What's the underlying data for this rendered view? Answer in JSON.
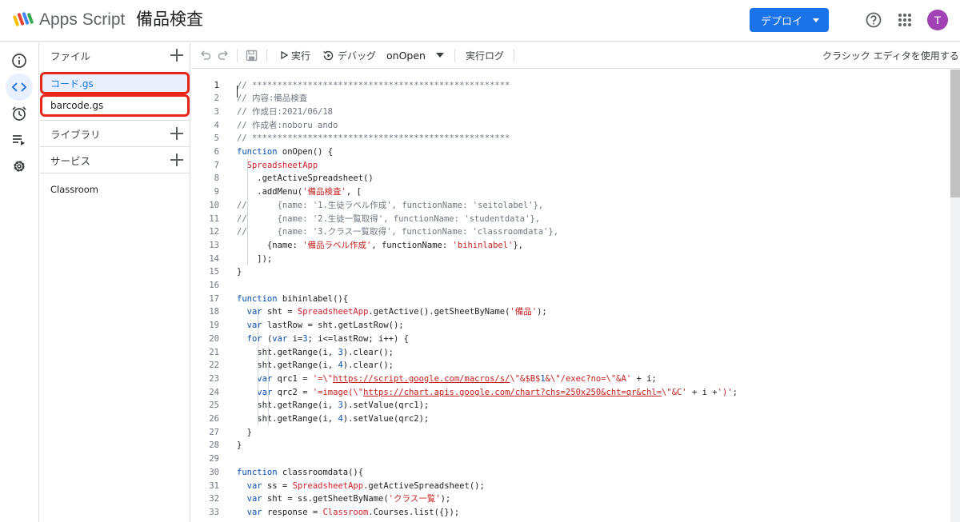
{
  "app": {
    "name": "Apps Script",
    "project_title": "備品検査"
  },
  "header": {
    "deploy_label": "デプロイ",
    "avatar_initial": "T"
  },
  "files_panel": {
    "files_header": "ファイル",
    "files": [
      {
        "name": "コード.gs",
        "active": true,
        "highlighted": true
      },
      {
        "name": "barcode.gs",
        "active": false,
        "highlighted": true
      }
    ],
    "libraries_header": "ライブラリ",
    "services_header": "サービス",
    "services": [
      "Classroom"
    ]
  },
  "toolbar": {
    "run_label": "実行",
    "debug_label": "デバッグ",
    "function_name": "onOpen",
    "log_label": "実行ログ",
    "classic_editor_label": "クラシック エディタを使用する"
  },
  "editor": {
    "current_line": 1,
    "lines": [
      {
        "n": "1",
        "t": "// ***************************************************",
        "c": "cm"
      },
      {
        "n": "2",
        "t": "// 内容:備品検査",
        "c": "cm"
      },
      {
        "n": "3",
        "t": "// 作成日:2021/06/18",
        "c": "cm"
      },
      {
        "n": "4",
        "t": "// 作成者:noboru ando",
        "c": "cm"
      },
      {
        "n": "5",
        "t": "// ***************************************************",
        "c": "cm"
      },
      {
        "n": "6",
        "t": "function onOpen() {",
        "c": "fn"
      },
      {
        "n": "7",
        "t": "  SpreadsheetApp",
        "c": "cls"
      },
      {
        "n": "8",
        "t": "    .getActiveSpreadsheet()",
        "c": ""
      },
      {
        "n": "9",
        "t": "    .addMenu('備品検査', [",
        "c": "menu"
      },
      {
        "n": "10",
        "t": "//      {name: '1.生徒ラベル作成', functionName: 'seitolabel'},",
        "c": "cm"
      },
      {
        "n": "11",
        "t": "//      {name: '2.生徒一覧取得', functionName: 'studentdata'},",
        "c": "cm"
      },
      {
        "n": "12",
        "t": "//      {name: '3.クラス一覧取得', functionName: 'classroomdata'},",
        "c": "cm"
      },
      {
        "n": "13",
        "t": "      {name: '備品ラベル作成', functionName: 'bihinlabel'},",
        "c": "obj"
      },
      {
        "n": "14",
        "t": "    ]);",
        "c": ""
      },
      {
        "n": "15",
        "t": "}",
        "c": ""
      },
      {
        "n": "16",
        "t": "",
        "c": ""
      },
      {
        "n": "17",
        "t": "function bihinlabel(){",
        "c": "fn"
      },
      {
        "n": "18",
        "t": "  var sht = SpreadsheetApp.getActive().getSheetByName('備品');",
        "c": "l18"
      },
      {
        "n": "19",
        "t": "  var lastRow = sht.getLastRow();",
        "c": "var"
      },
      {
        "n": "20",
        "t": "  for (var i=3; i<=lastRow; i++) {",
        "c": "for"
      },
      {
        "n": "21",
        "t": "    sht.getRange(i, 3).clear();",
        "c": "range"
      },
      {
        "n": "22",
        "t": "    sht.getRange(i, 4).clear();",
        "c": "range"
      },
      {
        "n": "23",
        "t": "    var qrc1 = '=\\\"https://script.google.com/macros/s/\\\"&$B$1&\\\"/exec?no=\\\"&A' + i;",
        "c": "q1"
      },
      {
        "n": "24",
        "t": "    var qrc2 = '=image(\\\"https://chart.apis.google.com/chart?chs=250x250&cht=qr&chl=\\\"&C' + i +')';",
        "c": "q2"
      },
      {
        "n": "25",
        "t": "    sht.getRange(i, 3).setValue(qrc1);",
        "c": "range"
      },
      {
        "n": "26",
        "t": "    sht.getRange(i, 4).setValue(qrc2);",
        "c": "range"
      },
      {
        "n": "27",
        "t": "  }",
        "c": ""
      },
      {
        "n": "28",
        "t": "}",
        "c": ""
      },
      {
        "n": "29",
        "t": "",
        "c": ""
      },
      {
        "n": "30",
        "t": "function classroomdata(){",
        "c": "fn"
      },
      {
        "n": "31",
        "t": "  var ss = SpreadsheetApp.getActiveSpreadsheet();",
        "c": "l31"
      },
      {
        "n": "32",
        "t": "  var sht = ss.getSheetByName('クラス一覧');",
        "c": "l32"
      },
      {
        "n": "33",
        "t": "  var response = Classroom.Courses.list({});",
        "c": "l33"
      }
    ]
  },
  "colors": {
    "accent": "#1a73e8",
    "highlight_box": "#e8261a",
    "active_file_bg": "#e8f0fe",
    "avatar": "#a142b4"
  },
  "icons": {
    "rail": [
      "info-icon",
      "code-icon",
      "alarm-clock-icon",
      "executions-icon",
      "gear-icon"
    ],
    "toolbar": [
      "undo-icon",
      "redo-icon",
      "save-icon",
      "play-icon",
      "debug-icon",
      "dropdown-icon"
    ],
    "header": [
      "apps-script-logo",
      "help-icon",
      "apps-grid-icon"
    ]
  }
}
